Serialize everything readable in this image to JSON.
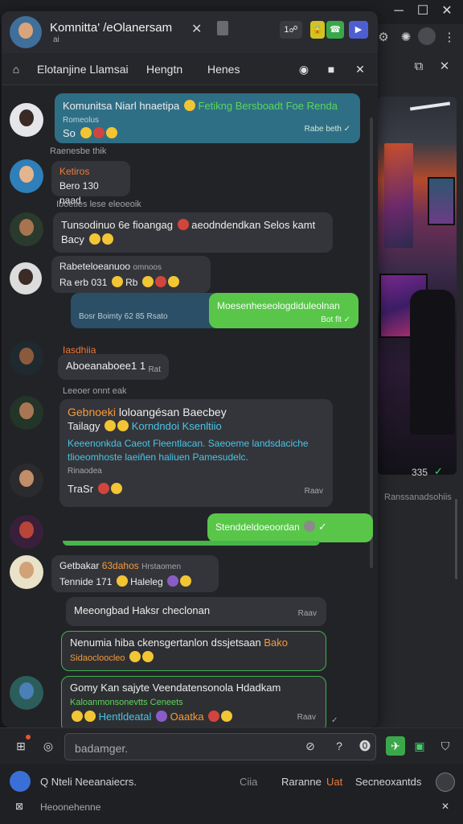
{
  "window": {
    "controls": [
      "─",
      "☐",
      "✕"
    ]
  },
  "header": {
    "title": "Komnitta' /eOlanersam",
    "subtitle": "ai",
    "pill_count": "1☍"
  },
  "tabs": {
    "items": [
      "Elotanjine Llamsai",
      "Hengtn",
      "Henes"
    ]
  },
  "messages": {
    "m1": {
      "text": "Komunitsa Niarl hnaetipa",
      "highlight": "Fetikng Bersboadt Foe Renda",
      "extra": "Romeolus",
      "line2": "So",
      "time": "Rabe beth"
    },
    "n1": "Raenesbe thik",
    "m2": {
      "sender": "Ketiros",
      "text": "Bero 130 naad"
    },
    "n2": "Iboeties lese eleoeoik",
    "m3": {
      "text": "Tunsodinuo 6e fioangag",
      "text2": "aeodndendkan Selos kamt",
      "line2": "Bacy"
    },
    "m4": {
      "line1": "Rabeteloeanuoo",
      "line1b": "omnoos",
      "line2": "Ra erb 031",
      "line2b": "Rb"
    },
    "m5": {
      "left": "Bosr Boimty 62 85 Rsato",
      "right": "Moesenheseologdiduleolnan",
      "time": "Bot flt"
    },
    "m6": {
      "sender": "Iasdhiia",
      "text": "Aboeanaboee1 1",
      "time": "Rat"
    },
    "n3": "Leeoer onnt eak",
    "m7": {
      "title": "Gebnoeki",
      "title2": "loloangésan Baecbey",
      "line2": "Tailagy",
      "highlight": "Korndndoi Ksenltiio",
      "teal": "Keeenonkda Caeot Fleentlacan. Saeoeme landsdaciche tlioeomhoste laeiñen haliuen Pamesudelc.",
      "sub": "Rinaodea",
      "line4": "TraSr",
      "time": "Raav"
    },
    "m8": {
      "text": "Stenddeldoeoordan",
      "time": ""
    },
    "m9": {
      "title": "Getbakar",
      "title_b": "63dahos",
      "title_c": "Hrstaomen",
      "line2": "Tennide 171",
      "line2b": "Haleleg"
    },
    "m10": {
      "text": "Meeongbad Haksr checlonan",
      "time": "Raav"
    },
    "m11": {
      "text": "Nenumia hiba ckensgertanlon dssjetsaan",
      "highlight": "Bako",
      "line2": "Sidaocloocleo"
    },
    "m12": {
      "title": "Gomy Kan sajyte Veendatensonola Hdadkam",
      "sub": "Kaloanmonsonevtts Ceneets",
      "line3": "Hentldeatal",
      "line3b": "Oaatka",
      "time": "Raav"
    }
  },
  "right_panel": {
    "time": "335",
    "caption": "Ranssanadsohiis"
  },
  "composer": {
    "placeholder": "badamger."
  },
  "bottom_bar": {
    "search": "Q Nteli Neeanaiecrs.",
    "item2": "Ciia",
    "item3": "Raranne",
    "item4": "Uat",
    "item5": "Secneoxantds",
    "footer": "Heoonehenne"
  },
  "colors": {
    "teal_bubble": "#2f6f86",
    "green_bubble": "#59c64a",
    "accent_orange": "#f07a3a",
    "accent_teal": "#48c5e6"
  },
  "icons": [
    "home-icon",
    "close-icon",
    "doc-icon",
    "phone-icon",
    "video-icon",
    "circle-icon",
    "record-icon",
    "attach-icon",
    "emoji-icon",
    "send-icon",
    "shield-icon"
  ]
}
